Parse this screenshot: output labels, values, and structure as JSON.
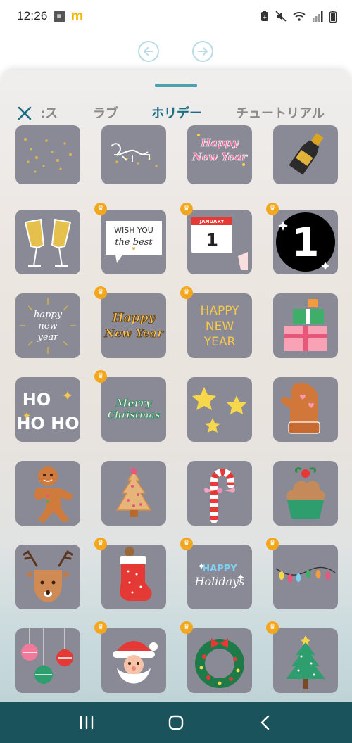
{
  "status_bar": {
    "time": "12:26",
    "icons_left": [
      "calendar-badge-icon",
      "mcdonalds-icon"
    ],
    "icons_right": [
      "battery-saver-icon",
      "mute-icon",
      "wifi-icon",
      "signal-icon",
      "battery-icon"
    ]
  },
  "history": {
    "undo_icon": "undo-arrow-icon",
    "redo_icon": "redo-arrow-icon"
  },
  "sheet": {
    "close_icon": "close-icon",
    "tabs": [
      {
        "label": ":ス",
        "active": false
      },
      {
        "label": "ラブ",
        "active": false
      },
      {
        "label": "ホリデー",
        "active": true
      },
      {
        "label": "チュートリアル",
        "active": false
      }
    ],
    "accent_color": "#1b6f84",
    "stickers": [
      {
        "name": "sparkle-numbers",
        "premium": false
      },
      {
        "name": "hello-2024-script",
        "premium": false
      },
      {
        "name": "happy-new-year-pink",
        "premium": false,
        "text_1": "Happy",
        "text_2": "New Year"
      },
      {
        "name": "champagne-bottle",
        "premium": false
      },
      {
        "name": "champagne-glasses",
        "premium": false
      },
      {
        "name": "wish-you-the-best",
        "premium": true,
        "text_1": "WISH YOU",
        "text_2": "the best"
      },
      {
        "name": "calendar-january-1",
        "premium": true,
        "text_1": "JANUARY",
        "text_2": "1"
      },
      {
        "name": "number-one-circle",
        "premium": true,
        "text_1": "1"
      },
      {
        "name": "happy-new-year-gold-burst",
        "premium": false,
        "text_1": "happy",
        "text_2": "new",
        "text_3": "year"
      },
      {
        "name": "happy-new-year-script",
        "premium": true,
        "text_1": "Happy",
        "text_2": "New Year"
      },
      {
        "name": "happy-new-year-block",
        "premium": true,
        "text_1": "HAPPY",
        "text_2": "NEW",
        "text_3": "YEAR"
      },
      {
        "name": "gift-boxes",
        "premium": false
      },
      {
        "name": "ho-ho-ho",
        "premium": false,
        "text_1": "HO",
        "text_2": "HO HO"
      },
      {
        "name": "merry-christmas",
        "premium": true,
        "text_1": "Merry",
        "text_2": "Christmas"
      },
      {
        "name": "yellow-stars",
        "premium": false
      },
      {
        "name": "gingerbread-mitten",
        "premium": false
      },
      {
        "name": "gingerbread-man",
        "premium": false
      },
      {
        "name": "tree-cookie",
        "premium": false
      },
      {
        "name": "candy-cane",
        "premium": false
      },
      {
        "name": "christmas-cupcake",
        "premium": false
      },
      {
        "name": "reindeer",
        "premium": false
      },
      {
        "name": "christmas-stocking",
        "premium": true
      },
      {
        "name": "happy-holidays",
        "premium": true,
        "text_1": "HAPPY",
        "text_2": "Holidays"
      },
      {
        "name": "string-lights",
        "premium": true
      },
      {
        "name": "ornaments",
        "premium": false
      },
      {
        "name": "santa-face",
        "premium": true
      },
      {
        "name": "christmas-wreath",
        "premium": true
      },
      {
        "name": "christmas-tree",
        "premium": true
      }
    ]
  },
  "nav_bar": {
    "recents_icon": "recents-icon",
    "home_icon": "home-icon",
    "back_icon": "back-icon"
  }
}
